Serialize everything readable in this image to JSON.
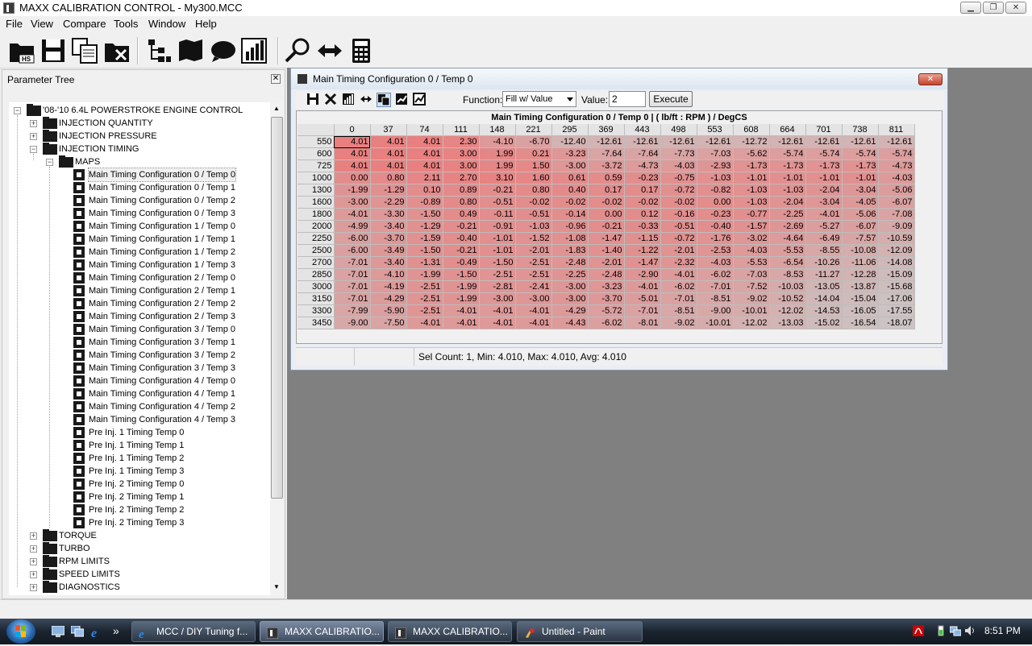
{
  "app": {
    "title": "MAXX CALIBRATION CONTROL - My300.MCC",
    "min_glyph": "▁",
    "max_glyph": "❐",
    "close_glyph": "✕"
  },
  "menu": [
    "File",
    "View",
    "Compare",
    "Tools",
    "Window",
    "Help"
  ],
  "toolbar_icons": [
    "open-hs-icon",
    "save-icon",
    "copy-icon",
    "close-file-icon",
    "tree-icon",
    "map-book-icon",
    "chat-icon",
    "chart-bars-icon",
    "search-icon",
    "swap-arrows-icon",
    "calculator-icon"
  ],
  "tree": {
    "title": "Parameter Tree",
    "close_glyph": "✕",
    "root": "'08-'10 6.4L POWERSTROKE ENGINE CONTROL",
    "groups_top": [
      "INJECTION QUANTITY",
      "INJECTION PRESSURE",
      "INJECTION TIMING"
    ],
    "maps_label": "MAPS",
    "maps": [
      "Main Timing Configuration 0 / Temp 0",
      "Main Timing Configuration 0 / Temp 1",
      "Main Timing Configuration 0 / Temp 2",
      "Main Timing Configuration 0 / Temp 3",
      "Main Timing Configuration 1 / Temp 0",
      "Main Timing Configuration 1 / Temp 1",
      "Main Timing Configuration 1 / Temp 2",
      "Main Timing Configuration 1 / Temp 3",
      "Main Timing Configuration 2 / Temp 0",
      "Main Timing Configuration 2 / Temp 1",
      "Main Timing Configuration 2 / Temp 2",
      "Main Timing Configuration 2 / Temp 3",
      "Main Timing Configuration 3 / Temp 0",
      "Main Timing Configuration 3 / Temp 1",
      "Main Timing Configuration 3 / Temp 2",
      "Main Timing Configuration 3 / Temp 3",
      "Main Timing Configuration 4 / Temp 0",
      "Main Timing Configuration 4 / Temp 1",
      "Main Timing Configuration 4 / Temp 2",
      "Main Timing Configuration 4 / Temp 3",
      "Pre Inj. 1 Timing Temp 0",
      "Pre Inj. 1 Timing Temp 1",
      "Pre Inj. 1 Timing Temp 2",
      "Pre Inj. 1 Timing Temp 3",
      "Pre Inj. 2 Timing Temp 0",
      "Pre Inj. 2 Timing Temp 1",
      "Pre Inj. 2 Timing Temp 2",
      "Pre Inj. 2 Timing Temp 3"
    ],
    "groups_bottom": [
      "TORQUE",
      "TURBO",
      "RPM LIMITS",
      "SPEED LIMITS",
      "DIAGNOSTICS"
    ]
  },
  "map_window": {
    "title": "Main Timing Configuration 0 / Temp 0",
    "close_glyph": "✕",
    "function_label": "Function:",
    "function_value": "Fill w/ Value",
    "value_label": "Value:",
    "value": "2",
    "execute_label": "Execute",
    "grid_title": "Main Timing Configuration 0 / Temp 0 |  ( lb/ft : RPM ) / DegCS",
    "columns": [
      "0",
      "37",
      "74",
      "111",
      "148",
      "221",
      "295",
      "369",
      "443",
      "498",
      "553",
      "608",
      "664",
      "701",
      "738",
      "811"
    ],
    "rows": [
      {
        "rpm": "550",
        "v": [
          "4.01",
          "4.01",
          "4.01",
          "2.30",
          "-4.10",
          "-6.70",
          "-12.40",
          "-12.61",
          "-12.61",
          "-12.61",
          "-12.61",
          "-12.72",
          "-12.61",
          "-12.61",
          "-12.61",
          "-12.61"
        ]
      },
      {
        "rpm": "600",
        "v": [
          "4.01",
          "4.01",
          "4.01",
          "3.00",
          "1.99",
          "0.21",
          "-3.23",
          "-7.64",
          "-7.64",
          "-7.73",
          "-7.03",
          "-5.62",
          "-5.74",
          "-5.74",
          "-5.74",
          "-5.74"
        ]
      },
      {
        "rpm": "725",
        "v": [
          "4.01",
          "4.01",
          "4.01",
          "3.00",
          "1.99",
          "1.50",
          "-3.00",
          "-3.72",
          "-4.73",
          "-4.03",
          "-2.93",
          "-1.73",
          "-1.73",
          "-1.73",
          "-1.73",
          "-4.73"
        ]
      },
      {
        "rpm": "1000",
        "v": [
          "0.00",
          "0.80",
          "2.11",
          "2.70",
          "3.10",
          "1.60",
          "0.61",
          "0.59",
          "-0.23",
          "-0.75",
          "-1.03",
          "-1.01",
          "-1.01",
          "-1.01",
          "-1.01",
          "-4.03"
        ]
      },
      {
        "rpm": "1300",
        "v": [
          "-1.99",
          "-1.29",
          "0.10",
          "0.89",
          "-0.21",
          "0.80",
          "0.40",
          "0.17",
          "0.17",
          "-0.72",
          "-0.82",
          "-1.03",
          "-1.03",
          "-2.04",
          "-3.04",
          "-5.06"
        ]
      },
      {
        "rpm": "1600",
        "v": [
          "-3.00",
          "-2.29",
          "-0.89",
          "0.80",
          "-0.51",
          "-0.02",
          "-0.02",
          "-0.02",
          "-0.02",
          "-0.02",
          "0.00",
          "-1.03",
          "-2.04",
          "-3.04",
          "-4.05",
          "-6.07"
        ]
      },
      {
        "rpm": "1800",
        "v": [
          "-4.01",
          "-3.30",
          "-1.50",
          "0.49",
          "-0.11",
          "-0.51",
          "-0.14",
          "0.00",
          "0.12",
          "-0.16",
          "-0.23",
          "-0.77",
          "-2.25",
          "-4.01",
          "-5.06",
          "-7.08"
        ]
      },
      {
        "rpm": "2000",
        "v": [
          "-4.99",
          "-3.40",
          "-1.29",
          "-0.21",
          "-0.91",
          "-1.03",
          "-0.96",
          "-0.21",
          "-0.33",
          "-0.51",
          "-0.40",
          "-1.57",
          "-2.69",
          "-5.27",
          "-6.07",
          "-9.09"
        ]
      },
      {
        "rpm": "2250",
        "v": [
          "-6.00",
          "-3.70",
          "-1.59",
          "-0.40",
          "-1.01",
          "-1.52",
          "-1.08",
          "-1.47",
          "-1.15",
          "-0.72",
          "-1.76",
          "-3.02",
          "-4.64",
          "-6.49",
          "-7.57",
          "-10.59"
        ]
      },
      {
        "rpm": "2500",
        "v": [
          "-6.00",
          "-3.49",
          "-1.50",
          "-0.21",
          "-1.01",
          "-2.01",
          "-1.83",
          "-1.40",
          "-1.22",
          "-2.01",
          "-2.53",
          "-4.03",
          "-5.53",
          "-8.55",
          "-10.08",
          "-12.09"
        ]
      },
      {
        "rpm": "2700",
        "v": [
          "-7.01",
          "-3.40",
          "-1.31",
          "-0.49",
          "-1.50",
          "-2.51",
          "-2.48",
          "-2.01",
          "-1.47",
          "-2.32",
          "-4.03",
          "-5.53",
          "-6.54",
          "-10.26",
          "-11.06",
          "-14.08"
        ]
      },
      {
        "rpm": "2850",
        "v": [
          "-7.01",
          "-4.10",
          "-1.99",
          "-1.50",
          "-2.51",
          "-2.51",
          "-2.25",
          "-2.48",
          "-2.90",
          "-4.01",
          "-6.02",
          "-7.03",
          "-8.53",
          "-11.27",
          "-12.28",
          "-15.09"
        ]
      },
      {
        "rpm": "3000",
        "v": [
          "-7.01",
          "-4.19",
          "-2.51",
          "-1.99",
          "-2.81",
          "-2.41",
          "-3.00",
          "-3.23",
          "-4.01",
          "-6.02",
          "-7.01",
          "-7.52",
          "-10.03",
          "-13.05",
          "-13.87",
          "-15.68"
        ]
      },
      {
        "rpm": "3150",
        "v": [
          "-7.01",
          "-4.29",
          "-2.51",
          "-1.99",
          "-3.00",
          "-3.00",
          "-3.00",
          "-3.70",
          "-5.01",
          "-7.01",
          "-8.51",
          "-9.02",
          "-10.52",
          "-14.04",
          "-15.04",
          "-17.06"
        ]
      },
      {
        "rpm": "3300",
        "v": [
          "-7.99",
          "-5.90",
          "-2.51",
          "-4.01",
          "-4.01",
          "-4.01",
          "-4.29",
          "-5.72",
          "-7.01",
          "-8.51",
          "-9.00",
          "-10.01",
          "-12.02",
          "-14.53",
          "-16.05",
          "-17.55"
        ]
      },
      {
        "rpm": "3450",
        "v": [
          "-9.00",
          "-7.50",
          "-4.01",
          "-4.01",
          "-4.01",
          "-4.01",
          "-4.43",
          "-6.02",
          "-8.01",
          "-9.02",
          "-10.01",
          "-12.02",
          "-13.03",
          "-15.02",
          "-16.54",
          "-18.07"
        ]
      }
    ],
    "status": "Sel Count: 1, Min: 4.010, Max: 4.010, Avg: 4.010"
  },
  "taskbar": {
    "tasks": [
      {
        "label": "MCC / DIY Tuning f...",
        "icon": "ie-icon",
        "active": false
      },
      {
        "label": "MAXX CALIBRATIO...",
        "icon": "maxx-icon",
        "active": true
      },
      {
        "label": "MAXX CALIBRATIO...",
        "icon": "maxx-icon",
        "active": false
      },
      {
        "label": "Untitled - Paint",
        "icon": "paint-icon",
        "active": false
      }
    ],
    "clock": "8:51 PM",
    "quick_launch_more": "»"
  }
}
